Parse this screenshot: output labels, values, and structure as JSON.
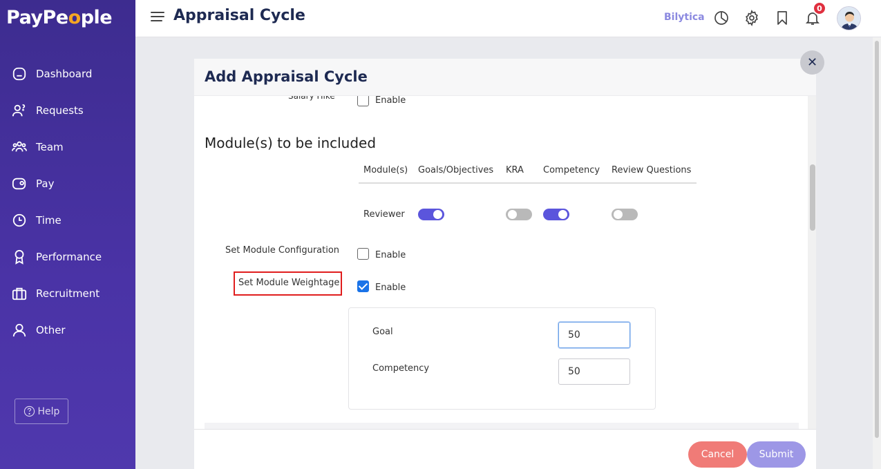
{
  "logo": {
    "prefix": "PayPe",
    "dot": "o",
    "suffix": "ple"
  },
  "sidebar": {
    "items": [
      {
        "label": "Dashboard",
        "icon": "home-icon"
      },
      {
        "label": "Requests",
        "icon": "person-question-icon"
      },
      {
        "label": "Team",
        "icon": "team-icon"
      },
      {
        "label": "Pay",
        "icon": "wallet-icon"
      },
      {
        "label": "Time",
        "icon": "clock-icon"
      },
      {
        "label": "Performance",
        "icon": "award-icon"
      },
      {
        "label": "Recruitment",
        "icon": "briefcase-icon"
      },
      {
        "label": "Other",
        "icon": "user-icon"
      }
    ],
    "help_label": "Help"
  },
  "header": {
    "title": "Appraisal Cycle",
    "company": "Bilytica",
    "notification_count": "0"
  },
  "modal": {
    "title": "Add Appraisal Cycle",
    "salary_hike_label": "Salary Hike",
    "enable_label": "Enable",
    "section_title": "Module(s) to be included",
    "columns": [
      "Module(s)",
      "Goals/Objectives",
      "KRA",
      "Competency",
      "Review Questions"
    ],
    "reviewer_row": {
      "label": "Reviewer",
      "toggles": {
        "goals": true,
        "kra": false,
        "competency": true,
        "review_questions": false
      }
    },
    "set_module_configuration": {
      "label": "Set Module Configuration",
      "checked": false
    },
    "set_module_weightage": {
      "label": "Set Module Weightage",
      "checked": true
    },
    "weights": [
      {
        "label": "Goal",
        "value": "50"
      },
      {
        "label": "Competency",
        "value": "50"
      }
    ],
    "cancel_label": "Cancel",
    "submit_label": "Submit"
  },
  "colors": {
    "sidebar": "#4a33a6",
    "accent": "#5b55dc",
    "cancel": "#f07b77",
    "submit": "#9d97e6",
    "highlight": "#e01d1d"
  }
}
